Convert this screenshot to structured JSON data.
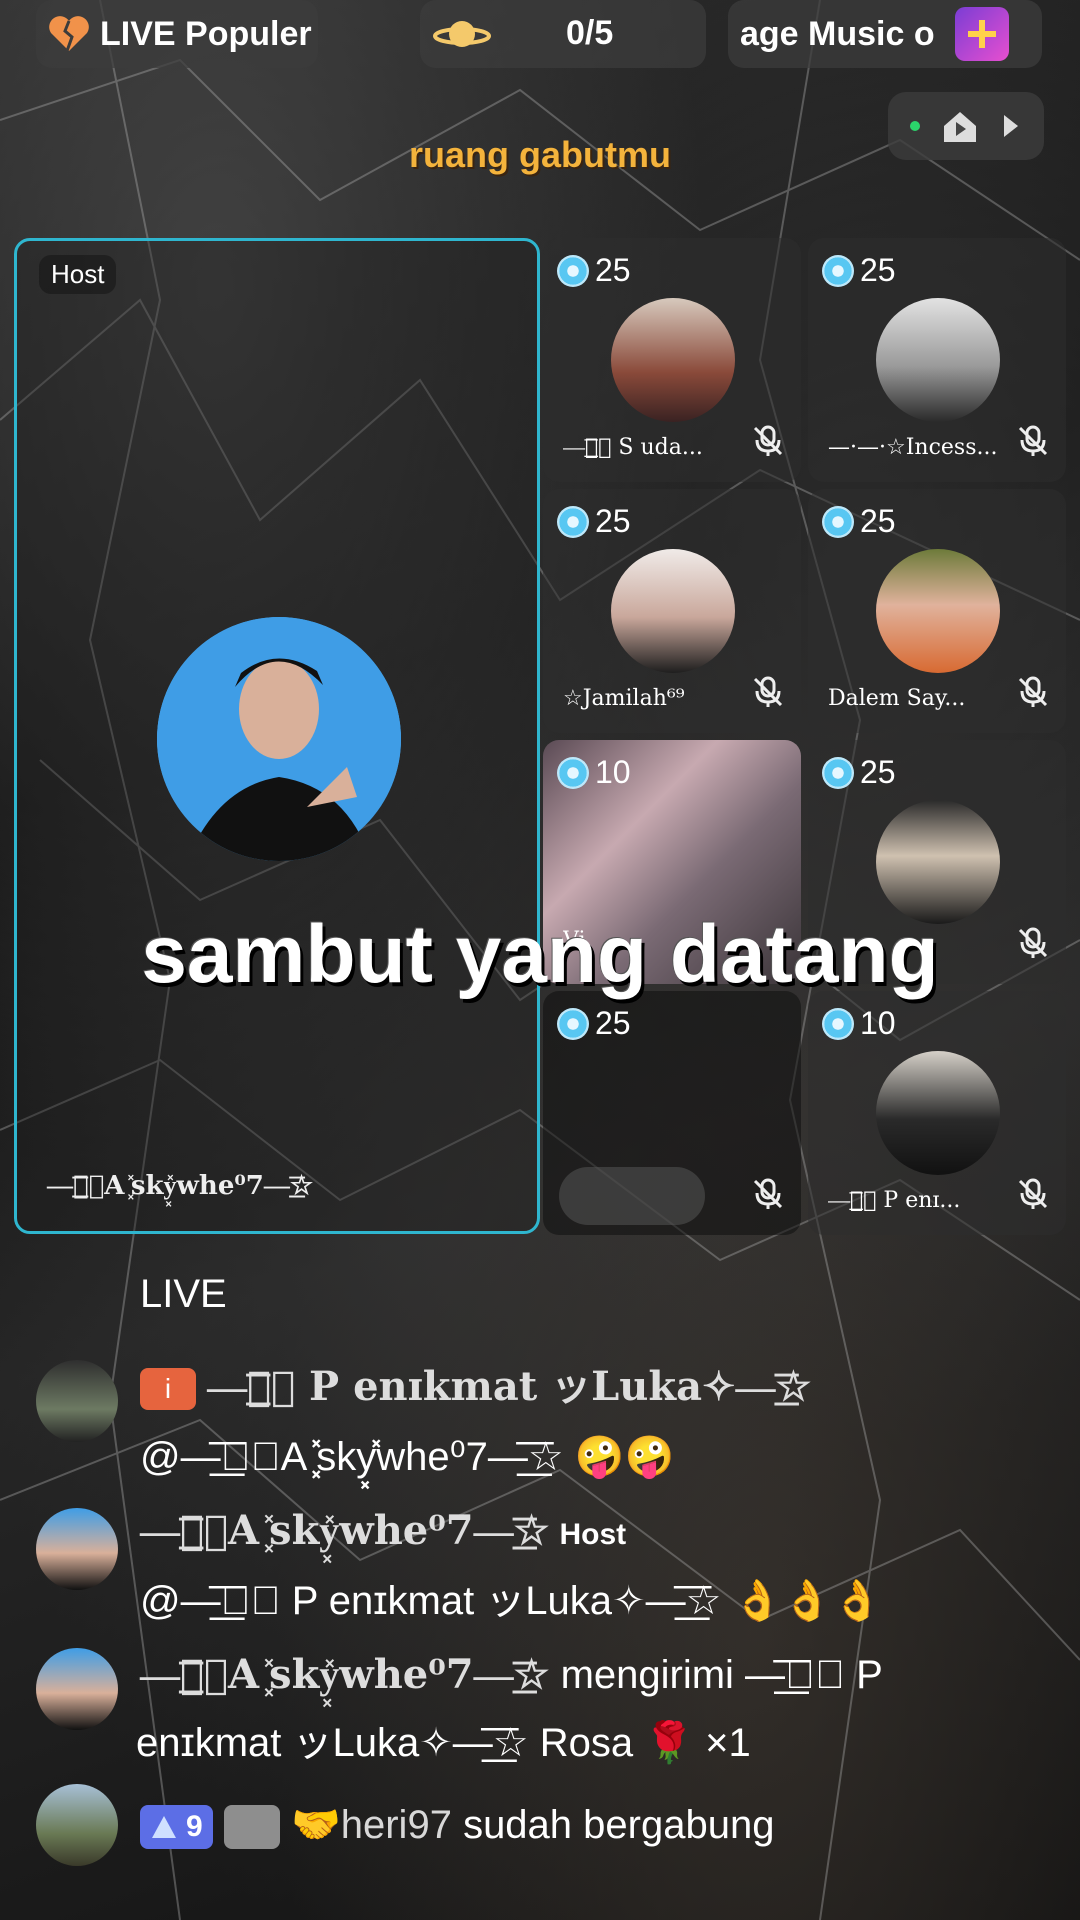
{
  "topbar": {
    "live_label": "LIVE Populer",
    "counter": "0/5",
    "music_label": "age  Music o"
  },
  "room_title": "ruang gabutmu",
  "host": {
    "tag": "Host",
    "name": "—͟͟͞☆⃝A ͓̽sky͓̽whe⁰7—͟͟͞☆"
  },
  "seats": [
    {
      "score": "25",
      "name": "—͟͟͞☆⃝ S uda..."
    },
    {
      "score": "25",
      "name": "—·—·☆Incess..."
    },
    {
      "score": "25",
      "name": "☆Jamilah⁶⁹"
    },
    {
      "score": "25",
      "name": "Dalem Say..."
    },
    {
      "score": "10",
      "name": "Vi"
    },
    {
      "score": "25",
      "name": ""
    },
    {
      "score": "25",
      "name": ""
    },
    {
      "score": "10",
      "name": "—͟͟͞☆⃝ P enɪ..."
    }
  ],
  "banner": "sambut yang datang",
  "chat": {
    "live_label": "LIVE",
    "messages": [
      {
        "name": "—͟͟͞☆⃝ P enɪkmat ッLuka✧—͟͟͞☆",
        "text": "@—͟͟͞☆⃝A ͓̽sky͓̽whe⁰7—͟͟͞☆ 🤪🤪",
        "badge": "i"
      },
      {
        "name": "—͟͟͞☆⃝A ͓̽sky͓̽whe⁰7—͟͟͞☆",
        "host_tag": "Host",
        "text": "@—͟͟͞☆⃝ P enɪkmat ッLuka✧—͟͟͞☆ 👌👌👌"
      },
      {
        "name": "—͟͟͞☆⃝A ͓̽sky͓̽whe⁰7—͟͟͞☆",
        "text": "mengirimi —͟͟͞☆⃝ P",
        "text2": "enɪkmat ッLuka✧—͟͟͞☆ Rosa 🌹 ×1"
      },
      {
        "level": "9",
        "name": "🤝heri97",
        "text": "sudah bergabung"
      }
    ]
  },
  "colors": {
    "accent_border": "#2fb6cf",
    "title_gold": "#f4b33c",
    "gem_blue": "#58c7f2"
  }
}
